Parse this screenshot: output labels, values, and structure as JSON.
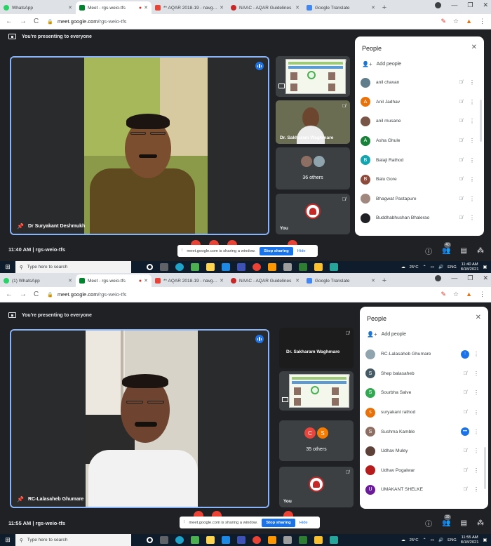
{
  "screens": [
    {
      "tabs": [
        {
          "label": "WhatsApp",
          "color": "#25d366"
        },
        {
          "label": "Meet - rgs-weio-tfs",
          "color": "#00832d"
        },
        {
          "label": "** AQAR 2018-19 - navgan2",
          "color": "#ea4335"
        },
        {
          "label": "NAAC - AQAR Guidelines",
          "color": "#c62828"
        },
        {
          "label": "Google Translate",
          "color": "#4285f4"
        }
      ],
      "url_host": "meet.google.com",
      "url_path": "/rgs-weio-tfs",
      "presenting_text": "You're presenting to everyone",
      "main_tile_name": "Dr Suryakant Deshmukh",
      "side_tiles": {
        "presenter_name": "Dr. Sakharam Waghmare",
        "others_count": "36 others",
        "avatar_letters": [
          "",
          ""
        ],
        "you_label": "You"
      },
      "people_panel": {
        "title": "People",
        "add_people": "Add people",
        "participants": [
          {
            "name": "anil chavan",
            "initial": "",
            "color": "#607d8b",
            "mic": "off"
          },
          {
            "name": "Anil Jadhav",
            "initial": "A",
            "color": "#e8710a",
            "mic": "off"
          },
          {
            "name": "anil musane",
            "initial": "",
            "color": "#795548",
            "mic": "off"
          },
          {
            "name": "Asha Ghule",
            "initial": "A",
            "color": "#188038",
            "mic": "off"
          },
          {
            "name": "Balaji Rathod",
            "initial": "B",
            "color": "#12a4af",
            "mic": "off"
          },
          {
            "name": "Balu Gore",
            "initial": "B",
            "color": "#8d4b3c",
            "mic": "off"
          },
          {
            "name": "Bhagwat Pastapure",
            "initial": "",
            "color": "#a1887f",
            "mic": "off"
          },
          {
            "name": "Buddhabhushan Bhalerao",
            "initial": "",
            "color": "#202124",
            "mic": "off"
          }
        ]
      },
      "meeting_time": "11:40 AM",
      "meeting_code": "rgs-weio-tfs",
      "share_notice": "meet.google.com is sharing a window.",
      "stop_sharing": "Stop sharing",
      "hide": "Hide",
      "participant_badge": "40",
      "taskbar": {
        "search_placeholder": "Type here to search",
        "temp": "25°C",
        "lang": "ENG",
        "time": "11:40 AM",
        "date": "8/18/2021"
      }
    },
    {
      "tabs": [
        {
          "label": "(1) WhatsApp",
          "color": "#25d366"
        },
        {
          "label": "Meet - rgs-weio-tfs",
          "color": "#00832d"
        },
        {
          "label": "** AQAR 2018-19 - navgan2",
          "color": "#ea4335"
        },
        {
          "label": "NAAC - AQAR Guidelines",
          "color": "#c62828"
        },
        {
          "label": "Google Translate",
          "color": "#4285f4"
        }
      ],
      "url_host": "meet.google.com",
      "url_path": "/rgs-weio-tfs",
      "presenting_text": "You're presenting to everyone",
      "main_tile_name": "RC-Lalasaheb Ghumare",
      "side_tiles": {
        "presenter_name": "Dr. Sakharam Waghmare",
        "others_count": "35 others",
        "avatar_letters": [
          "C",
          "S"
        ],
        "you_label": "You"
      },
      "people_panel": {
        "title": "People",
        "add_people": "Add people",
        "participants": [
          {
            "name": "RC-Lalasaheb Ghumare",
            "initial": "",
            "color": "#90a4ae",
            "mic": "on"
          },
          {
            "name": "Shep balasaheb",
            "initial": "S",
            "color": "#455a64",
            "mic": "off"
          },
          {
            "name": "Sourbha Salve",
            "initial": "S",
            "color": "#33a852",
            "mic": "off"
          },
          {
            "name": "suryakant rathod",
            "initial": "s",
            "color": "#e8710a",
            "mic": "off"
          },
          {
            "name": "Sushma Kamble",
            "initial": "S",
            "color": "#8d6e63",
            "mic": "more"
          },
          {
            "name": "Udhav Muley",
            "initial": "",
            "color": "#5d4037",
            "mic": "off"
          },
          {
            "name": "Udhav Pogalwar",
            "initial": "",
            "color": "#b71c1c",
            "mic": "off"
          },
          {
            "name": "UMAKANT SHELKE",
            "initial": "U",
            "color": "#6a1b9a",
            "mic": "off"
          }
        ]
      },
      "meeting_time": "11:55 AM",
      "meeting_code": "rgs-weio-tfs",
      "share_notice": "meet.google.com is sharing a window.",
      "stop_sharing": "Stop sharing",
      "hide": "Hide",
      "participant_badge": "39",
      "taskbar": {
        "search_placeholder": "Type here to search",
        "temp": "25°C",
        "lang": "ENG",
        "time": "11:55 AM",
        "date": "8/18/2021"
      }
    }
  ]
}
